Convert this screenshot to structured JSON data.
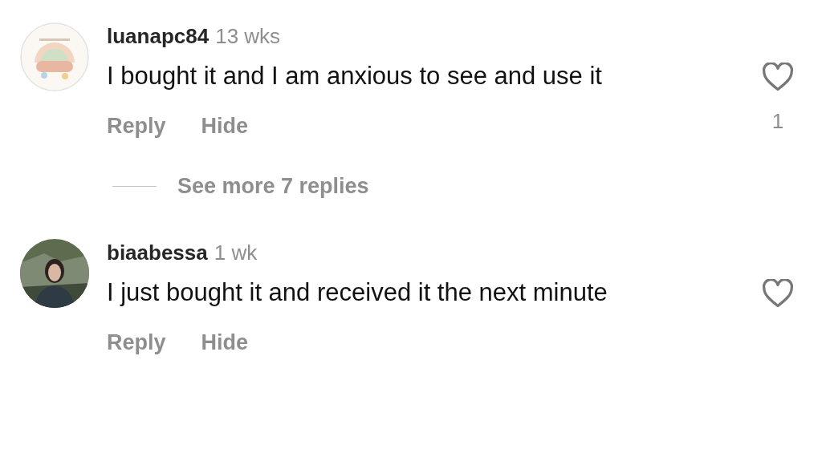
{
  "comments": [
    {
      "username": "luanapc84",
      "time": "13 wks",
      "text": "I bought it and I am anxious to see and use it",
      "actions": [
        "Reply",
        "Hide"
      ],
      "liked": false,
      "likes": "1",
      "more_replies": "See more 7 replies"
    },
    {
      "username": "biaabessa",
      "time": "1 wk",
      "text": "I just bought it and received it the next minute",
      "actions": [
        "Reply",
        "Hide"
      ],
      "liked": false
    }
  ]
}
